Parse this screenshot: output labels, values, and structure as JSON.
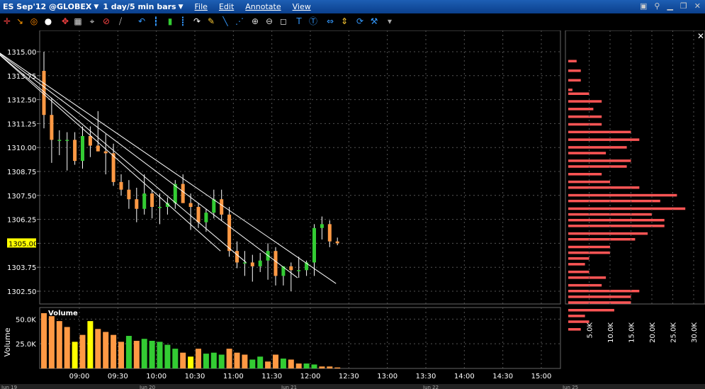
{
  "title": {
    "symbol": "ES Sep'12 @GLOBEX",
    "timeframe": "1 day/5 min bars"
  },
  "menu": [
    "File",
    "Edit",
    "Annotate",
    "View"
  ],
  "toolbar_icons": [
    "crosshair-icon",
    "arrow-tool-icon",
    "target-icon",
    "circle-icon",
    "move-icon",
    "layout-icon",
    "cursor-icon",
    "no-draw-icon",
    "line-icon",
    "undo-icon",
    "bars-icon",
    "candles-icon",
    "bars-alt-icon",
    "redo-icon",
    "pen-icon",
    "trendline-icon",
    "fan-icon",
    "zoom-in-icon",
    "zoom-out-icon",
    "fit-icon",
    "text-icon",
    "text-box-icon",
    "split-icon",
    "scale-icon",
    "refresh-icon",
    "wrench-icon",
    "more-icon"
  ],
  "price_axis": {
    "labels": [
      "1315.00",
      "1313.75",
      "1312.50",
      "1311.25",
      "1310.00",
      "1308.75",
      "1307.50",
      "1306.25",
      "1305.00",
      "1303.75",
      "1302.50"
    ],
    "current_price": "1305.00"
  },
  "volume_axis": {
    "title": "Volume",
    "labels": [
      "50.0K",
      "25.0K"
    ]
  },
  "time_axis": {
    "labels": [
      "09:00",
      "09:30",
      "10:00",
      "10:30",
      "11:00",
      "11:30",
      "12:00",
      "12:30",
      "13:00",
      "13:30",
      "14:00",
      "14:30",
      "15:00"
    ]
  },
  "bottom_dates": [
    "Jun 19",
    "Jun 20",
    "Jun 21",
    "Jun 22",
    "Jun 25"
  ],
  "profile_axis": {
    "labels": [
      "5.0K",
      "10.0K",
      "15.0K",
      "20.0K",
      "25.0K",
      "30.0K"
    ]
  },
  "volume_label": "Volume",
  "colors": {
    "up": "#33cc33",
    "down": "#ff9944",
    "profile": "#ff5555",
    "price_tag": "#ffff00"
  },
  "chart_data": {
    "type": "candlestick",
    "candles": [
      [
        1314.0,
        1315.0,
        1311.0,
        1311.7
      ],
      [
        1311.7,
        1312.6,
        1309.2,
        1310.4
      ],
      [
        1310.4,
        1310.9,
        1309.6,
        1310.4
      ],
      [
        1310.4,
        1310.8,
        1308.8,
        1310.4
      ],
      [
        1310.4,
        1310.8,
        1309.1,
        1309.3
      ],
      [
        1309.3,
        1311.1,
        1308.9,
        1310.6
      ],
      [
        1310.6,
        1311.1,
        1309.5,
        1310.1
      ],
      [
        1310.1,
        1311.9,
        1309.8,
        1309.8
      ],
      [
        1309.8,
        1310.7,
        1308.6,
        1309.7
      ],
      [
        1309.7,
        1310.2,
        1308.0,
        1308.2
      ],
      [
        1308.2,
        1308.6,
        1307.5,
        1307.8
      ],
      [
        1307.8,
        1308.3,
        1306.8,
        1307.3
      ],
      [
        1307.3,
        1307.9,
        1306.1,
        1306.8
      ],
      [
        1306.8,
        1308.6,
        1306.5,
        1307.6
      ],
      [
        1307.6,
        1307.8,
        1306.3,
        1306.9
      ],
      [
        1306.9,
        1307.6,
        1306.0,
        1306.9
      ],
      [
        1306.9,
        1307.4,
        1306.5,
        1307.1
      ],
      [
        1307.1,
        1308.3,
        1306.8,
        1308.1
      ],
      [
        1308.1,
        1308.6,
        1307.1,
        1307.1
      ],
      [
        1307.1,
        1307.6,
        1305.7,
        1306.9
      ],
      [
        1306.9,
        1307.1,
        1305.8,
        1306.1
      ],
      [
        1306.1,
        1306.8,
        1305.6,
        1306.6
      ],
      [
        1306.6,
        1307.8,
        1306.3,
        1307.3
      ],
      [
        1307.3,
        1307.8,
        1306.2,
        1306.5
      ],
      [
        1306.5,
        1306.9,
        1304.3,
        1304.6
      ],
      [
        1304.6,
        1305.1,
        1303.7,
        1304.0
      ],
      [
        1304.0,
        1304.6,
        1303.3,
        1304.0
      ],
      [
        1304.0,
        1304.4,
        1303.0,
        1303.8
      ],
      [
        1303.8,
        1304.5,
        1303.5,
        1304.1
      ],
      [
        1304.1,
        1305.0,
        1303.1,
        1304.6
      ],
      [
        1304.6,
        1304.8,
        1302.8,
        1303.3
      ],
      [
        1303.3,
        1303.8,
        1302.8,
        1303.8
      ],
      [
        1303.8,
        1304.0,
        1302.5,
        1303.6
      ],
      [
        1303.6,
        1304.3,
        1303.2,
        1303.6
      ],
      [
        1303.6,
        1304.1,
        1303.3,
        1304.0
      ],
      [
        1304.0,
        1306.0,
        1303.3,
        1305.8
      ],
      [
        1305.8,
        1306.4,
        1305.2,
        1306.0
      ],
      [
        1306.0,
        1306.2,
        1304.8,
        1305.1
      ],
      [
        1305.1,
        1305.3,
        1304.9,
        1305.0
      ]
    ],
    "volume": [
      56,
      53,
      48,
      42,
      27,
      34,
      48,
      40,
      37,
      34,
      27,
      33,
      28,
      30,
      28,
      27,
      24,
      20,
      16,
      12,
      20,
      15,
      16,
      14,
      20,
      16,
      14,
      9,
      12,
      7,
      14,
      10,
      9,
      5,
      5,
      4,
      2,
      2,
      1
    ],
    "trendlines": [
      {
        "from": [
          "07:50",
          1315.3
        ],
        "to": [
          "12:20",
          1302.9
        ]
      },
      {
        "from": [
          "07:50",
          1315.3
        ],
        "to": [
          "11:50",
          1303.2
        ]
      },
      {
        "from": [
          "07:50",
          1315.3
        ],
        "to": [
          "11:10",
          1304.0
        ]
      },
      {
        "from": [
          "07:50",
          1315.3
        ],
        "to": [
          "10:50",
          1304.6
        ]
      }
    ],
    "profile": [
      [
        1314.5,
        2
      ],
      [
        1314.0,
        3
      ],
      [
        1313.5,
        3
      ],
      [
        1313.0,
        1
      ],
      [
        1312.8,
        5
      ],
      [
        1312.4,
        8
      ],
      [
        1312.0,
        6
      ],
      [
        1311.6,
        8
      ],
      [
        1311.2,
        8
      ],
      [
        1310.8,
        15
      ],
      [
        1310.4,
        17
      ],
      [
        1310.0,
        14
      ],
      [
        1309.7,
        9
      ],
      [
        1309.3,
        15
      ],
      [
        1309.0,
        14
      ],
      [
        1308.6,
        8
      ],
      [
        1308.2,
        10
      ],
      [
        1307.9,
        17
      ],
      [
        1307.5,
        26
      ],
      [
        1307.2,
        22
      ],
      [
        1306.8,
        28
      ],
      [
        1306.5,
        20
      ],
      [
        1306.2,
        23
      ],
      [
        1305.9,
        23
      ],
      [
        1305.5,
        19
      ],
      [
        1305.2,
        16
      ],
      [
        1304.8,
        10
      ],
      [
        1304.5,
        10
      ],
      [
        1304.2,
        5
      ],
      [
        1303.9,
        4
      ],
      [
        1303.5,
        5
      ],
      [
        1303.2,
        9
      ],
      [
        1302.8,
        8
      ],
      [
        1302.5,
        17
      ],
      [
        1302.2,
        15
      ],
      [
        1301.9,
        15
      ],
      [
        1301.5,
        11
      ],
      [
        1301.2,
        4
      ],
      [
        1300.9,
        5
      ],
      [
        1300.5,
        3
      ]
    ]
  }
}
